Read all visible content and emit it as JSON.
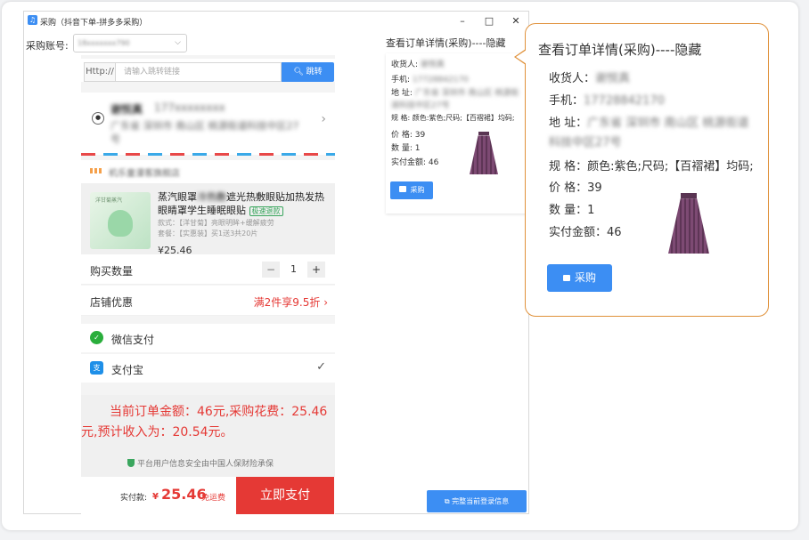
{
  "window": {
    "title": "采购（抖音下单-拼多多采购）",
    "minimize": "–",
    "maximize": "□",
    "close": "✕"
  },
  "account": {
    "label": "采购账号:",
    "value": "18xxxxxxx790",
    "chevron": "⌵"
  },
  "url_bar": {
    "prefix": "Http://",
    "placeholder": "请输入跳转链接",
    "go_label": "跳转",
    "search_icon": "search-icon"
  },
  "address": {
    "name": "谢悦真",
    "phone": "177xxxxxxxx",
    "line": "广东省 深圳市 南山区 桃源街道科技中区27号"
  },
  "shop": {
    "name": "机乐童漫客旗舰店"
  },
  "product": {
    "title_a": "蒸汽眼罩",
    "title_b": "冷热敷",
    "title_c": "遮光热敷眼贴加热发热眼睛罩学生睡眠眼贴",
    "badge": "极速退款",
    "spec1": "款式：【洋甘菊】亮眼明眸+缓解疲劳",
    "spec2": "套餐：【实惠装】买1送3共20片",
    "price": "¥25.46",
    "image_caption": "洋甘菊蒸汽"
  },
  "quantity": {
    "label": "购买数量",
    "minus": "−",
    "value": "1",
    "plus": "+"
  },
  "shop_discount": {
    "label": "店铺优惠",
    "value": "满2件享9.5折",
    "arrow": "›"
  },
  "payment": {
    "wechat": "微信支付",
    "alipay": "支付宝",
    "selected_mark": "✓"
  },
  "summary": {
    "text": "当前订单金额：46元,采购花费：25.46元,预计收入为：20.54元。",
    "safety": "平台用户信息安全由中国人保财险承保"
  },
  "checkout": {
    "paid_label": "实付款:",
    "currency": "¥",
    "amount": "25.46",
    "free_shipping": "免运费",
    "submit": "立即支付"
  },
  "detail_small": {
    "header": "查看订单详情(采购)----隐藏",
    "receiver_label": "收货人:",
    "receiver_value": "谢悦真",
    "phone_label": "手机:",
    "phone_value": "17728842170",
    "address_label": "地 址:",
    "address_value1": "广东省 深圳市 南山区 桃源街",
    "address_value2": "道科技中区27号",
    "spec": "规 格: 颜色:紫色;尺码;【百褶裙】均码;",
    "price": "价 格: 39",
    "qty": "数 量: 1",
    "paid": "实付金额: 46",
    "buy": "采购"
  },
  "restore_button": "完整当前登录信息",
  "popup": {
    "title": "查看订单详情(采购)----隐藏",
    "receiver_label": "收货人：",
    "receiver_value": "谢悦真",
    "phone_label": "手机：",
    "phone_value": "17728842170",
    "address_label": "地 址：",
    "address_value1": "广东省 深圳市 南山区 桃源街道",
    "address_value2": "科技中区27号",
    "spec": "规 格：颜色:紫色;尺码;【百褶裙】均码;",
    "price": "价 格：39",
    "qty": "数 量：1",
    "paid": "实付金额：46",
    "buy": "采购"
  },
  "colors": {
    "accent_blue": "#3c8ef3",
    "price_red": "#e53935",
    "popup_border": "#e0913a",
    "skirt_purple": "#7d4a73"
  }
}
